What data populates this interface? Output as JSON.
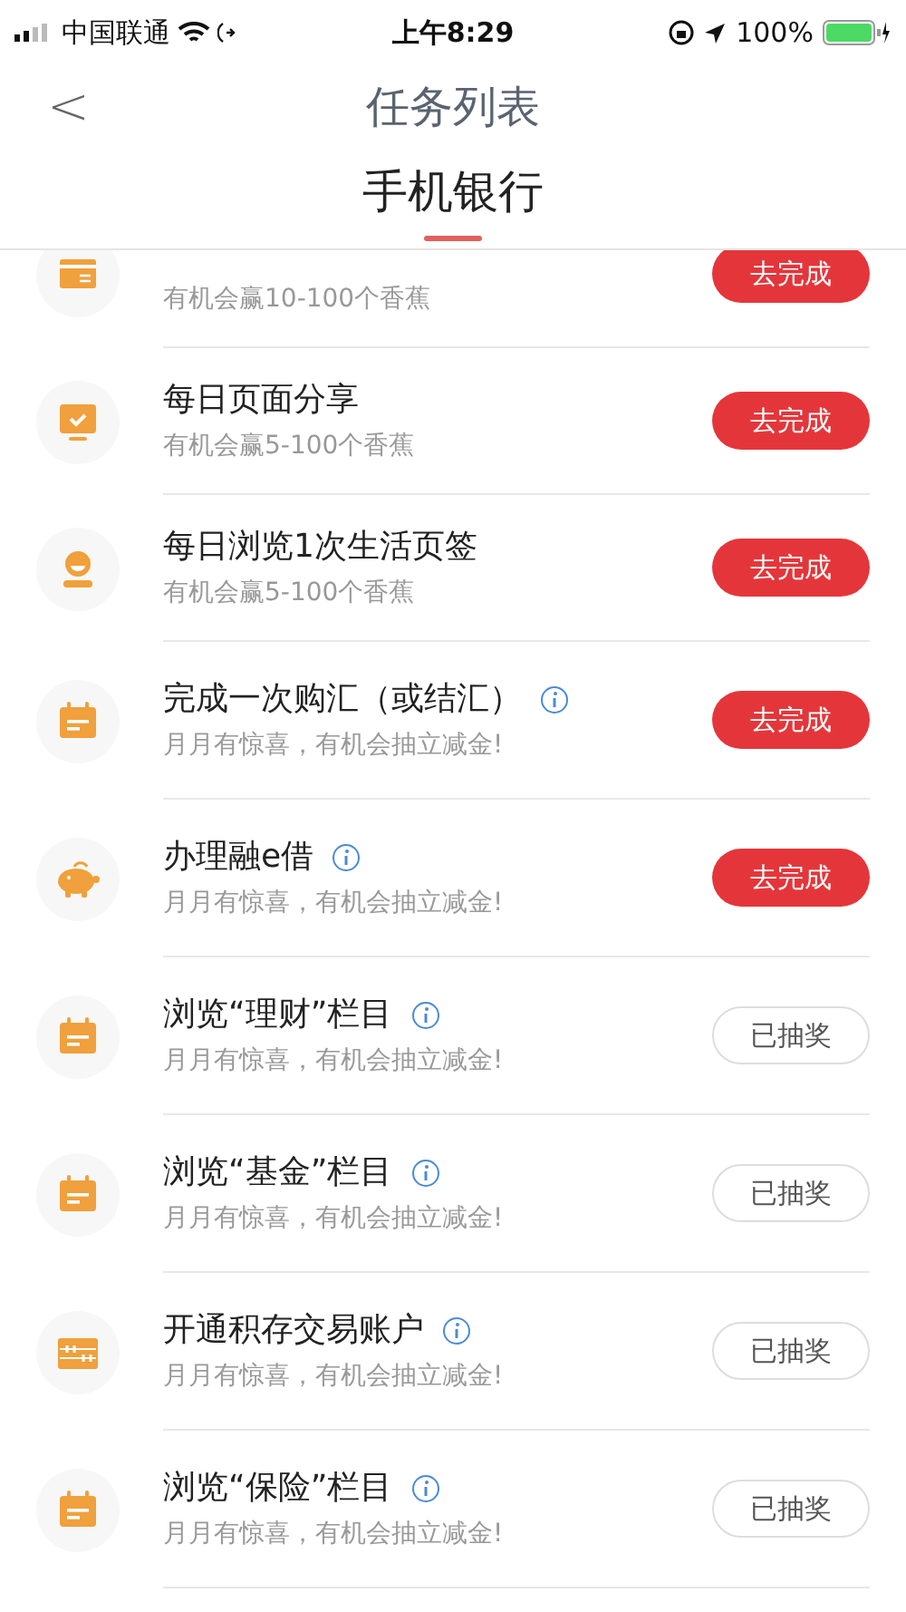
{
  "status_bar": {
    "carrier": "中国联通",
    "time": "上午8:29",
    "battery": "100%"
  },
  "nav": {
    "back": "<",
    "title": "任务列表"
  },
  "tabs": [
    {
      "label": "手机银行",
      "selected": true
    }
  ],
  "tasks": [
    {
      "kind": "card",
      "subtitle": "有机会赢10-100个香蕉",
      "info": false,
      "button": "去完成",
      "done": false
    },
    {
      "kind": "monitor",
      "title": "每日页面分享",
      "subtitle": "有机会赢5-100个香蕉",
      "info": false,
      "button": "去完成",
      "done": false
    },
    {
      "kind": "person",
      "title": "每日浏览1次生活页签",
      "subtitle": "有机会赢5-100个香蕉",
      "info": false,
      "button": "去完成",
      "done": false
    },
    {
      "kind": "calendar",
      "title": "完成一次购汇（或结汇）",
      "subtitle": "月月有惊喜，有机会抽立减金!",
      "info": true,
      "button": "去完成",
      "done": false
    },
    {
      "kind": "piggy",
      "title": "办理融e借",
      "subtitle": "月月有惊喜，有机会抽立减金!",
      "info": true,
      "button": "去完成",
      "done": false
    },
    {
      "kind": "calendar",
      "title": "浏览“理财”栏目",
      "subtitle": "月月有惊喜，有机会抽立减金!",
      "info": true,
      "button": "已抽奖",
      "done": true
    },
    {
      "kind": "calendar",
      "title": "浏览“基金”栏目",
      "subtitle": "月月有惊喜，有机会抽立减金!",
      "info": true,
      "button": "已抽奖",
      "done": true
    },
    {
      "kind": "abacus",
      "title": "开通积存交易账户",
      "subtitle": "月月有惊喜，有机会抽立减金!",
      "info": true,
      "button": "已抽奖",
      "done": true
    },
    {
      "kind": "calendar",
      "title": "浏览“保险”栏目",
      "subtitle": "月月有惊喜，有机会抽立减金!",
      "info": true,
      "button": "已抽奖",
      "done": true
    }
  ]
}
